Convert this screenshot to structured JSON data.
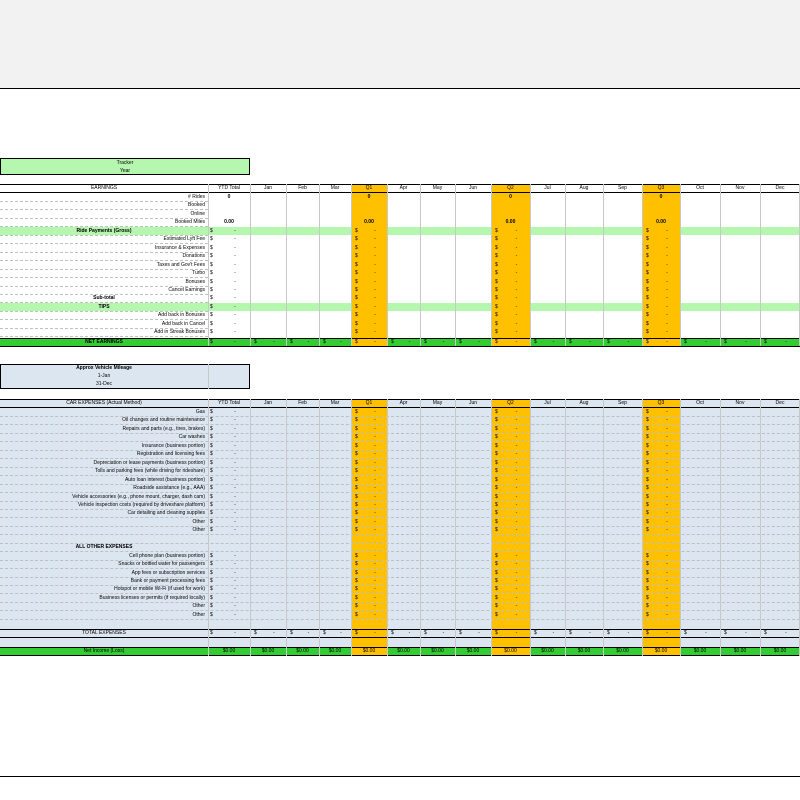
{
  "tracker": {
    "title": "Tracker",
    "subtitle": "Year"
  },
  "earnings": {
    "header": "EARNINGS",
    "ytd_header": "YTD Total",
    "months": [
      "Jan",
      "Feb",
      "Mar",
      "Q1",
      "Apr",
      "May",
      "Jun",
      "Q2",
      "Jul",
      "Aug",
      "Sep",
      "Q3",
      "Oct",
      "Nov",
      "Dec"
    ],
    "rows": [
      "# Rides",
      "Booked",
      "Online",
      "Booked Miles",
      "Ride Payments (Gross)",
      "Estimated Lyft Fee",
      "Insurance & Expenses",
      "Donations",
      "Taxes and Gov't Fees",
      "Turbo",
      "Bonuses",
      "Cancel Earnings",
      "Sub-total",
      "TIPS",
      "Add back in Bonuses",
      "Add back in Cancel",
      "Add in Streak Bonuses"
    ],
    "net_label": "NET EARNINGS",
    "rides_value": "0",
    "miles_value": "0.00",
    "dollar": "$",
    "dash": "-"
  },
  "mileage": {
    "title": "Approx Vehicle Mileage",
    "start": "1-Jan",
    "end": "31-Dec"
  },
  "expenses": {
    "header": "CAR EXPENSES (Actual Method)",
    "ytd_header": "YTD Total",
    "car_rows": [
      "Gas",
      "Oil changes and routine maintenance",
      "Repairs and parts (e.g., tires, brakes)",
      "Car washes",
      "Insurance (business portion)",
      "Registration and licensing fees",
      "Depreciation or lease payments (business portion)",
      "Tolls and parking fees (while driving for rideshare)",
      "Auto loan interest (business portion)",
      "Roadside assistance (e.g., AAA)",
      "Vehicle accessories (e.g., phone mount, charger, dash cam)",
      "Vehicle inspection costs (required by driveshare platform)",
      "Car detailing and cleaning supplies",
      "Other",
      "Other"
    ],
    "other_header": "ALL OTHER EXPENSES",
    "other_rows": [
      "Cell phone plan (business portion)",
      "Snacks or bottled water for passengers",
      "App fees or subscription services",
      "Bank or payment processing fees",
      "Hotspot or mobile Wi-Fi (if used for work)",
      "Business licenses or permits (if required locally)",
      "Other",
      "Other"
    ],
    "total_label": "TOTAL EXPENSES",
    "net_income_label": "Net Income (Loss)",
    "net_income_value": "$0.00"
  },
  "colors": {
    "orange": "#ffc000",
    "light_green": "#b6f7b0",
    "green": "#33cc33",
    "light_blue": "#dce6f1"
  }
}
